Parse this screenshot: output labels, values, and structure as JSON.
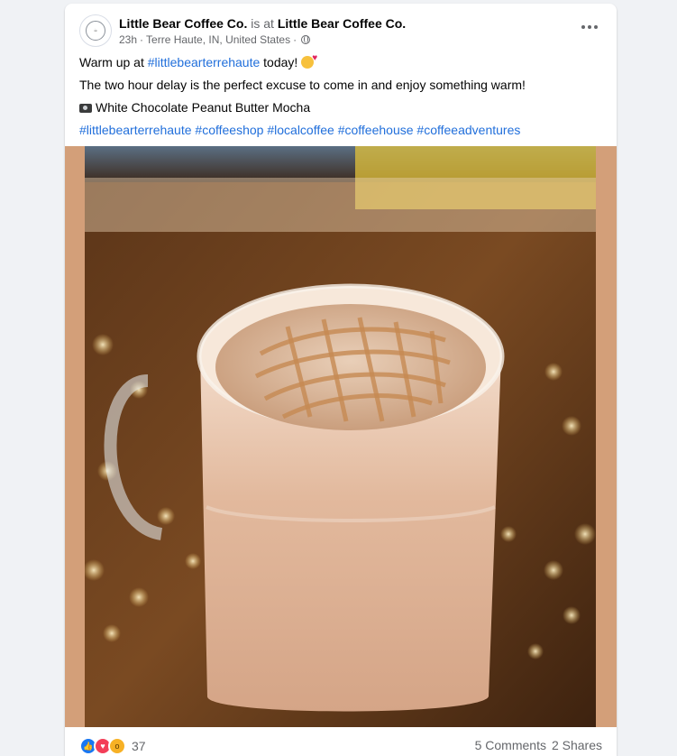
{
  "post": {
    "author": "Little Bear Coffee Co.",
    "connector": "is at",
    "location_name": "Little Bear Coffee Co.",
    "time": "23h",
    "place": "Terre Haute, IN, United States",
    "separator": "·",
    "audience_icon": "globe-icon",
    "more_icon": "more-options-icon"
  },
  "content": {
    "line1_prefix": "Warm up at ",
    "line1_hashtag": "#littlebearterrehaute",
    "line1_suffix": " today! ",
    "line1_emoji": "smiling-face-with-hearts",
    "line2": "The two hour delay is the perfect excuse to come in and enjoy something warm!",
    "line3_icon": "camera-icon",
    "line3": "White Chocolate Peanut Butter Mocha",
    "hashtags": [
      "#littlebearterrehaute",
      "#coffeeshop",
      "#localcoffee",
      "#coffeehouse",
      "#coffeeadventures"
    ]
  },
  "photo": {
    "subject": "mug-of-latte-icon",
    "background_color": "#d39f79"
  },
  "footer": {
    "reaction_icons": [
      "like-icon",
      "love-icon",
      "wow-icon"
    ],
    "reaction_count": "37",
    "comments": "5 Comments",
    "shares": "2 Shares"
  },
  "colors": {
    "link": "#216fdb",
    "muted": "#65676b",
    "like": "#1877f2",
    "love": "#f33e58",
    "wow": "#f7b125"
  }
}
